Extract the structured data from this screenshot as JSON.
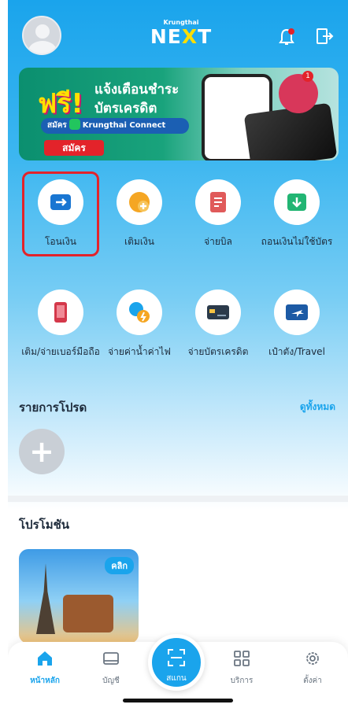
{
  "header": {
    "logo_small": "Krungthai",
    "logo_big_1": "NE",
    "logo_big_x": "X",
    "logo_big_2": "T"
  },
  "banner": {
    "free": "ฟรี!",
    "line1": "แจ้งเตือนชำระ",
    "line2": "บัตรเครดิต",
    "pill_prefix": "สมัคร",
    "pill_service": "Krungthai Connect",
    "apply_button": "สมัคร",
    "badge_count": "1"
  },
  "services": [
    {
      "label": "โอนเงิน",
      "icon": "transfer-icon",
      "color": "#1976d2"
    },
    {
      "label": "เติมเงิน",
      "icon": "topup-coin-icon",
      "color": "#f5a623"
    },
    {
      "label": "จ่ายบิล",
      "icon": "bill-icon",
      "color": "#e05a5a"
    },
    {
      "label": "ถอนเงินไม่ใช้บัตร",
      "icon": "cardless-withdraw-icon",
      "color": "#22b573"
    },
    {
      "label": "เติม/จ่ายเบอร์มือถือ",
      "icon": "mobile-topup-icon",
      "color": "#d4384a"
    },
    {
      "label": "จ่ายค่าน้ำค่าไฟ",
      "icon": "utility-icon",
      "color": "#1aa4ec"
    },
    {
      "label": "จ่ายบัตรเครดิต",
      "icon": "credit-card-icon",
      "color": "#2b3a4a"
    },
    {
      "label": "เป๋าตัง/Travel",
      "icon": "travel-plane-icon",
      "color": "#1c5aa5"
    }
  ],
  "favorites": {
    "title": "รายการโปรด",
    "see_all": "ดูทั้งหมด",
    "add": "+"
  },
  "promotions": {
    "title": "โปรโมชัน",
    "card_tag": "คลิก"
  },
  "tabbar": {
    "home": "หน้าหลัก",
    "accounts": "บัญชี",
    "scan": "สแกน",
    "services": "บริการ",
    "settings": "ตั้งค่า"
  },
  "colors": {
    "accent": "#1aa4ec",
    "highlight": "#e3232a"
  }
}
